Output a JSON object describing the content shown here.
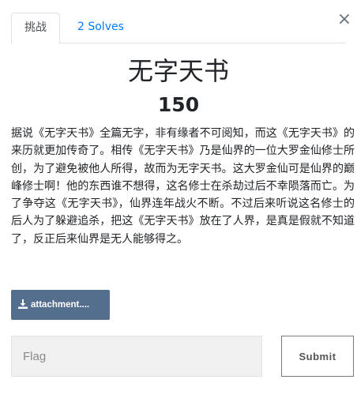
{
  "tabs": {
    "challenge_label": "挑战",
    "solves_label": "2 Solves"
  },
  "close_glyph": "×",
  "challenge": {
    "name": "无字天书",
    "value": "150",
    "description": "据说《无字天书》全篇无字，非有缘者不可阅知，而这《无字天书》的来历就更加传奇了。相传《无字天书》乃是仙界的一位大罗金仙修士所创，为了避免被他人所得，故而为无字天书。这大罗金仙可是仙界的巅峰修士啊！他的东西谁不想得，这名修士在杀劫过后不幸陨落而亡。为了争夺这《无字天书》，仙界连年战火不断。不过后来听说这名修士的后人为了躲避追杀，把这《无字天书》放在了人界，是真是假就不知道了，反正后来仙界是无人能够得之。"
  },
  "attachment": {
    "label": "attachment....",
    "icon": "download-icon"
  },
  "flag_form": {
    "placeholder": "Flag",
    "value": "",
    "submit_label": "Submit"
  },
  "colors": {
    "link": "#007bff",
    "attachment_bg": "#546e8e",
    "input_bg": "#f0f0f0"
  }
}
